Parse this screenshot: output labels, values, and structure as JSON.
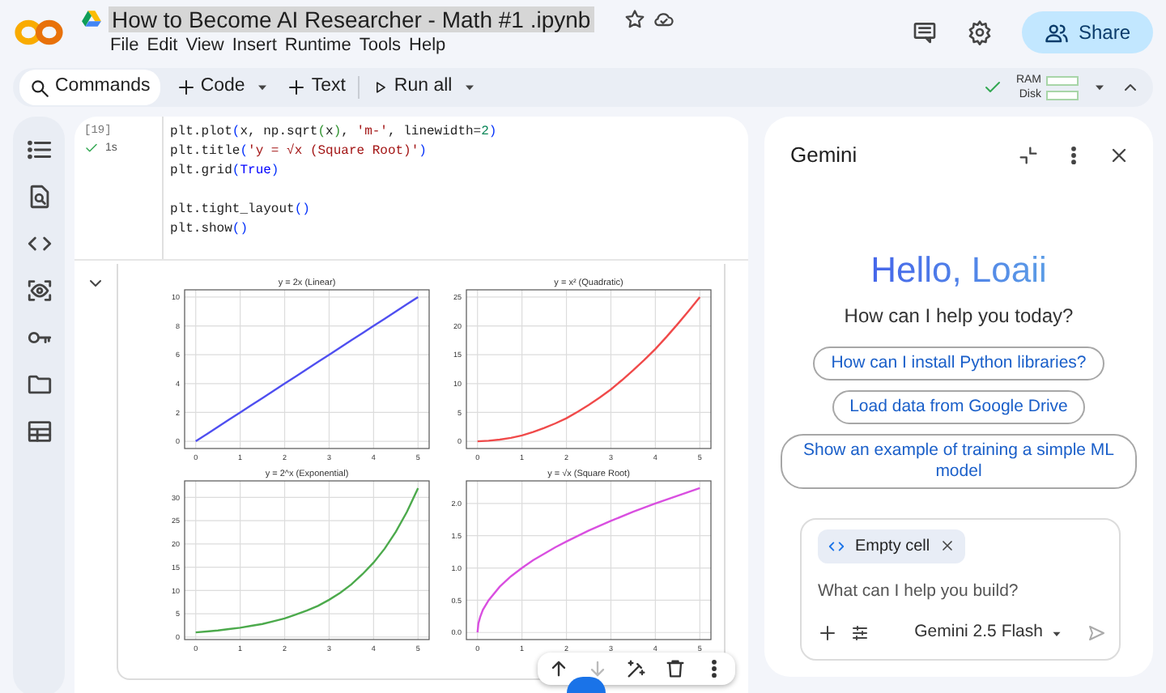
{
  "header": {
    "title": "How to Become AI Researcher - Math #1 .ipynb",
    "title_highlighted": true,
    "menu": [
      "File",
      "Edit",
      "View",
      "Insert",
      "Runtime",
      "Tools",
      "Help"
    ],
    "share_label": "Share"
  },
  "toolbar": {
    "items": [
      {
        "kind": "commands",
        "label": "Commands",
        "has_menu": false
      },
      {
        "kind": "add",
        "label": "Code",
        "has_menu": true
      },
      {
        "kind": "add",
        "label": "Text",
        "has_menu": false
      },
      {
        "kind": "run",
        "label": "Run all",
        "has_menu": true
      }
    ],
    "connected": true,
    "meters": [
      {
        "label": "RAM",
        "level": 0
      },
      {
        "label": "Disk",
        "level": 0
      }
    ]
  },
  "cell": {
    "execution_count": "[19]",
    "succeeded": true,
    "duration": "1s",
    "code_blocks": [
      [
        [
          {
            "text": "plt.plot",
            "kind": "plain"
          },
          {
            "text": "(",
            "kind": "paren1"
          },
          {
            "text": "x, np.sqrt",
            "kind": "plain"
          },
          {
            "text": "(",
            "kind": "paren2"
          },
          {
            "text": "x",
            "kind": "plain"
          },
          {
            "text": ")",
            "kind": "paren2"
          },
          {
            "text": ", ",
            "kind": "plain"
          },
          {
            "text": "'m-'",
            "kind": "string"
          },
          {
            "text": ", linewidth=",
            "kind": "plain"
          },
          {
            "text": "2",
            "kind": "number"
          },
          {
            "text": ")",
            "kind": "paren1"
          }
        ],
        [
          {
            "text": "plt.title",
            "kind": "plain"
          },
          {
            "text": "(",
            "kind": "paren1"
          },
          {
            "text": "'y = √x (Square Root)'",
            "kind": "string"
          },
          {
            "text": ")",
            "kind": "paren1"
          }
        ],
        [
          {
            "text": "plt.grid",
            "kind": "plain"
          },
          {
            "text": "(",
            "kind": "paren1"
          },
          {
            "text": "True",
            "kind": "keyword"
          },
          {
            "text": ")",
            "kind": "paren1"
          }
        ]
      ],
      [
        [
          {
            "text": "plt.tight_layout",
            "kind": "plain"
          },
          {
            "text": "()",
            "kind": "paren1"
          }
        ],
        [
          {
            "text": "plt.show",
            "kind": "plain"
          },
          {
            "text": "()",
            "kind": "paren1"
          }
        ]
      ]
    ]
  },
  "output": {
    "expanded": true,
    "charts": [
      {
        "chart_data": {
          "type": "line",
          "grid": true,
          "title": "y = 2x (Linear)",
          "x": [
            0,
            0.25,
            0.5,
            0.75,
            1,
            1.25,
            1.5,
            1.75,
            2,
            2.25,
            2.5,
            2.75,
            3,
            3.25,
            3.5,
            3.75,
            4,
            4.25,
            4.5,
            4.75,
            5
          ],
          "xlim": [
            -0.25,
            5.25
          ],
          "ylim": [
            -0.5,
            10.5
          ],
          "xticks": [
            0,
            1,
            2,
            3,
            4,
            5
          ],
          "yticks": [
            0,
            2,
            4,
            6,
            8,
            10
          ],
          "series": [
            {
              "color": "#4f4ff0",
              "values": [
                0,
                0.5,
                1,
                1.5,
                2,
                2.5,
                3,
                3.5,
                4,
                4.5,
                5,
                5.5,
                6,
                6.5,
                7,
                7.5,
                8,
                8.5,
                9,
                9.5,
                10
              ]
            }
          ]
        }
      },
      {
        "chart_data": {
          "type": "line",
          "grid": true,
          "title": "y = x² (Quadratic)",
          "x": [
            0,
            0.25,
            0.5,
            0.75,
            1,
            1.25,
            1.5,
            1.75,
            2,
            2.25,
            2.5,
            2.75,
            3,
            3.25,
            3.5,
            3.75,
            4,
            4.25,
            4.5,
            4.75,
            5
          ],
          "xlim": [
            -0.25,
            5.25
          ],
          "ylim": [
            -1.25,
            26.25
          ],
          "xticks": [
            0,
            1,
            2,
            3,
            4,
            5
          ],
          "yticks": [
            0,
            5,
            10,
            15,
            20,
            25
          ],
          "series": [
            {
              "color": "#f04a4a",
              "values": [
                0,
                0.1,
                0.3,
                0.6,
                1,
                1.6,
                2.3,
                3.1,
                4,
                5.1,
                6.3,
                7.6,
                9,
                10.6,
                12.3,
                14.1,
                16,
                18.1,
                20.3,
                22.6,
                25
              ]
            }
          ]
        }
      },
      {
        "chart_data": {
          "type": "line",
          "grid": true,
          "title": "y = 2^x (Exponential)",
          "x": [
            0,
            0.25,
            0.5,
            0.75,
            1,
            1.25,
            1.5,
            1.75,
            2,
            2.25,
            2.5,
            2.75,
            3,
            3.25,
            3.5,
            3.75,
            4,
            4.25,
            4.5,
            4.75,
            5
          ],
          "xlim": [
            -0.25,
            5.25
          ],
          "ylim": [
            -0.55,
            33.55
          ],
          "xticks": [
            0,
            1,
            2,
            3,
            4,
            5
          ],
          "yticks": [
            0,
            5,
            10,
            15,
            20,
            25,
            30
          ],
          "series": [
            {
              "color": "#4caa4c",
              "values": [
                1,
                1.2,
                1.4,
                1.7,
                2,
                2.4,
                2.8,
                3.4,
                4,
                4.8,
                5.7,
                6.7,
                8,
                9.5,
                11.3,
                13.5,
                16,
                19,
                22.6,
                26.9,
                32
              ]
            }
          ]
        }
      },
      {
        "chart_data": {
          "type": "line",
          "grid": true,
          "title": "y = √x (Square Root)",
          "x": [
            0,
            0.02,
            0.06,
            0.12,
            0.25,
            0.5,
            0.75,
            1,
            1.25,
            1.5,
            1.75,
            2,
            2.5,
            3,
            3.5,
            4,
            4.5,
            5
          ],
          "xlim": [
            -0.25,
            5.25
          ],
          "ylim": [
            -0.11,
            2.35
          ],
          "xticks": [
            0,
            1,
            2,
            3,
            4,
            5
          ],
          "yticks": [
            {
              "value": 0,
              "label": "0.0"
            },
            {
              "value": 0.5,
              "label": "0.5"
            },
            {
              "value": 1,
              "label": "1.0"
            },
            {
              "value": 1.5,
              "label": "1.5"
            },
            {
              "value": 2,
              "label": "2.0"
            }
          ],
          "series": [
            {
              "color": "#d94fe0",
              "values": [
                0,
                0.14,
                0.24,
                0.35,
                0.5,
                0.71,
                0.87,
                1,
                1.12,
                1.22,
                1.32,
                1.41,
                1.58,
                1.73,
                1.87,
                2,
                2.12,
                2.24
              ]
            }
          ]
        }
      }
    ]
  },
  "gemini": {
    "title": "Gemini",
    "greeting": "Hello, Loaii",
    "subtitle": "How can I help you today?",
    "suggestions": [
      "How can I install Python libraries?",
      "Load data from Google Drive",
      "Show an example of training a simple ML model"
    ],
    "context_chip": "Empty cell",
    "placeholder": "What can I help you build?",
    "model": "Gemini 2.5 Flash"
  }
}
